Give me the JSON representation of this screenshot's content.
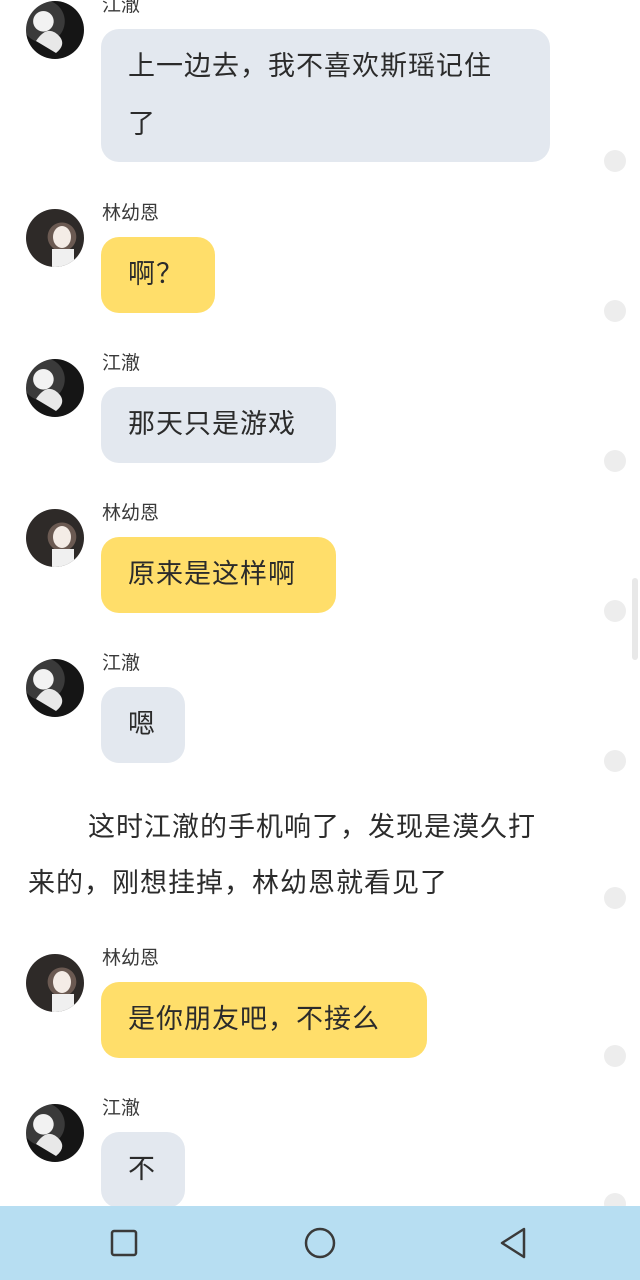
{
  "messages": [
    {
      "sender": "江澈",
      "text_line1": "上一边去，我不喜欢斯瑶记住",
      "text_line2": "了",
      "style": "gray"
    },
    {
      "sender": "林幼恩",
      "text": "啊？",
      "style": "yellow"
    },
    {
      "sender": "江澈",
      "text": "那天只是游戏",
      "style": "gray"
    },
    {
      "sender": "林幼恩",
      "text": "原来是这样啊",
      "style": "yellow"
    },
    {
      "sender": "江澈",
      "text": "嗯",
      "style": "gray"
    },
    {
      "sender": "林幼恩",
      "text": "是你朋友吧，不接么",
      "style": "yellow"
    },
    {
      "sender": "江澈",
      "text": "不",
      "style": "gray"
    }
  ],
  "narration": {
    "line1": "这时江澈的手机响了，发现是漠久打",
    "line2": "来的，刚想挂掉，林幼恩就看见了"
  },
  "colors": {
    "gray_bubble": "#e3e8ef",
    "yellow_bubble": "#ffde6a",
    "navbar": "#b7def2"
  },
  "navbar": {
    "icons": [
      "square-icon",
      "circle-icon",
      "triangle-back-icon"
    ]
  }
}
